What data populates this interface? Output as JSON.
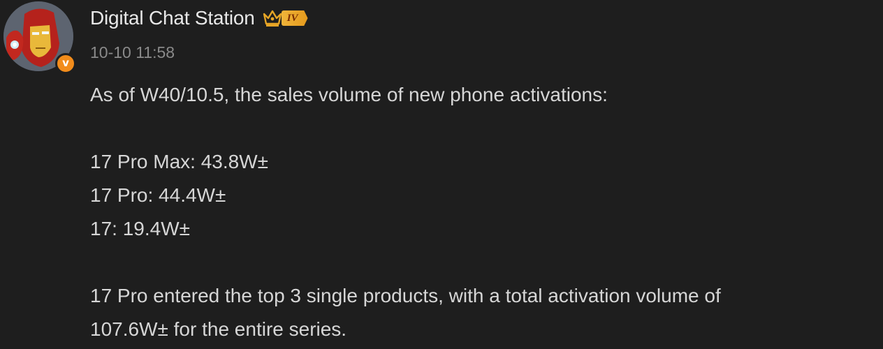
{
  "post": {
    "author": "Digital Chat Station",
    "level_badge": "IV",
    "timestamp": "10-10 11:58",
    "intro": "As of W40/10.5, the sales volume of new phone activations:",
    "stats": [
      "17 Pro Max: 43.8W±",
      "17 Pro: 44.4W±",
      "17: 19.4W±"
    ],
    "conclusion_line1": "17 Pro entered the top 3 single products, with a total activation volume of",
    "conclusion_line2": "107.6W± for the entire series.",
    "icons": {
      "avatar": "iron-man-avatar",
      "verified": "verified-v-badge-icon",
      "crown": "crown-icon"
    },
    "colors": {
      "background": "#1e1e1e",
      "verified_badge": "#f28c1b",
      "level_badge": "#f0b43a"
    }
  }
}
